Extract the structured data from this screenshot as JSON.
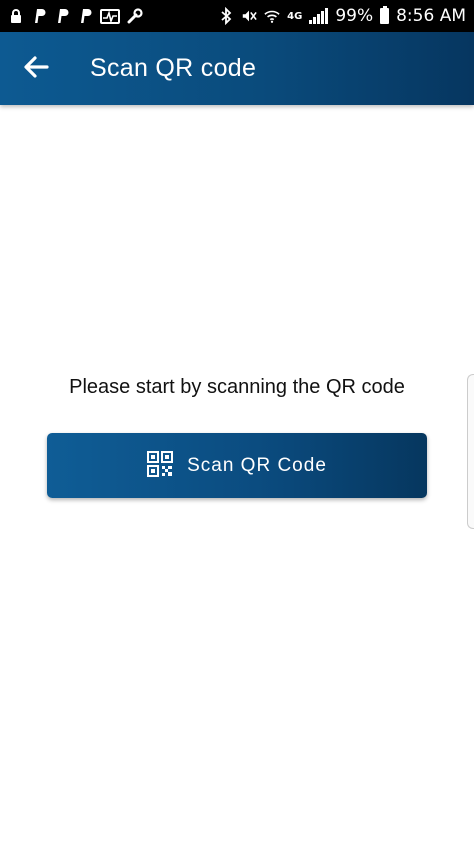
{
  "status_bar": {
    "left_icons": [
      "lock-icon",
      "paypal-icon",
      "paypal-icon",
      "paypal-icon",
      "pulse-icon",
      "wrench-icon"
    ],
    "right_icons": [
      "bluetooth-icon",
      "mute-icon",
      "wifi-icon",
      "signal-icon",
      "battery-icon"
    ],
    "network": "4G",
    "battery": "99%",
    "time": "8:56 AM"
  },
  "app_bar": {
    "back_icon": "arrow-left-icon",
    "title": "Scan QR code",
    "background": "#0a4b7c"
  },
  "main": {
    "prompt": "Please start by scanning the QR code",
    "scan_button": {
      "icon": "qr-code-icon",
      "label": "Scan QR Code"
    }
  },
  "colors": {
    "primary": "#0b4c80",
    "primary_dark": "#06375f",
    "text": "#111111"
  }
}
